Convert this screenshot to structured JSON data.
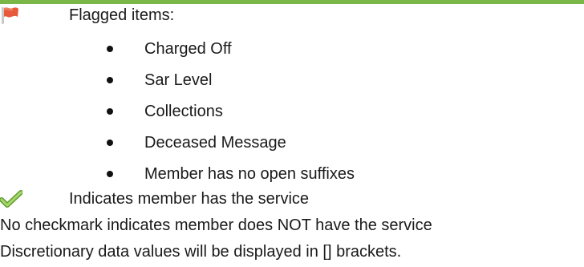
{
  "flagged": {
    "heading": "Flagged items:",
    "items": [
      "Charged Off",
      "Sar Level",
      "Collections",
      "Deceased Message",
      "Member has no open suffixes"
    ],
    "icon": "red-flag-icon",
    "flag_color": "#e8583a"
  },
  "service": {
    "text": "Indicates member has the service",
    "icon": "green-checkmark-icon",
    "check_color": "#7ab648"
  },
  "notes": {
    "no_checkmark": "No checkmark indicates member does NOT have the service",
    "discretionary": "Discretionary data values will be displayed in [] brackets."
  },
  "accent_color": "#7ab648"
}
